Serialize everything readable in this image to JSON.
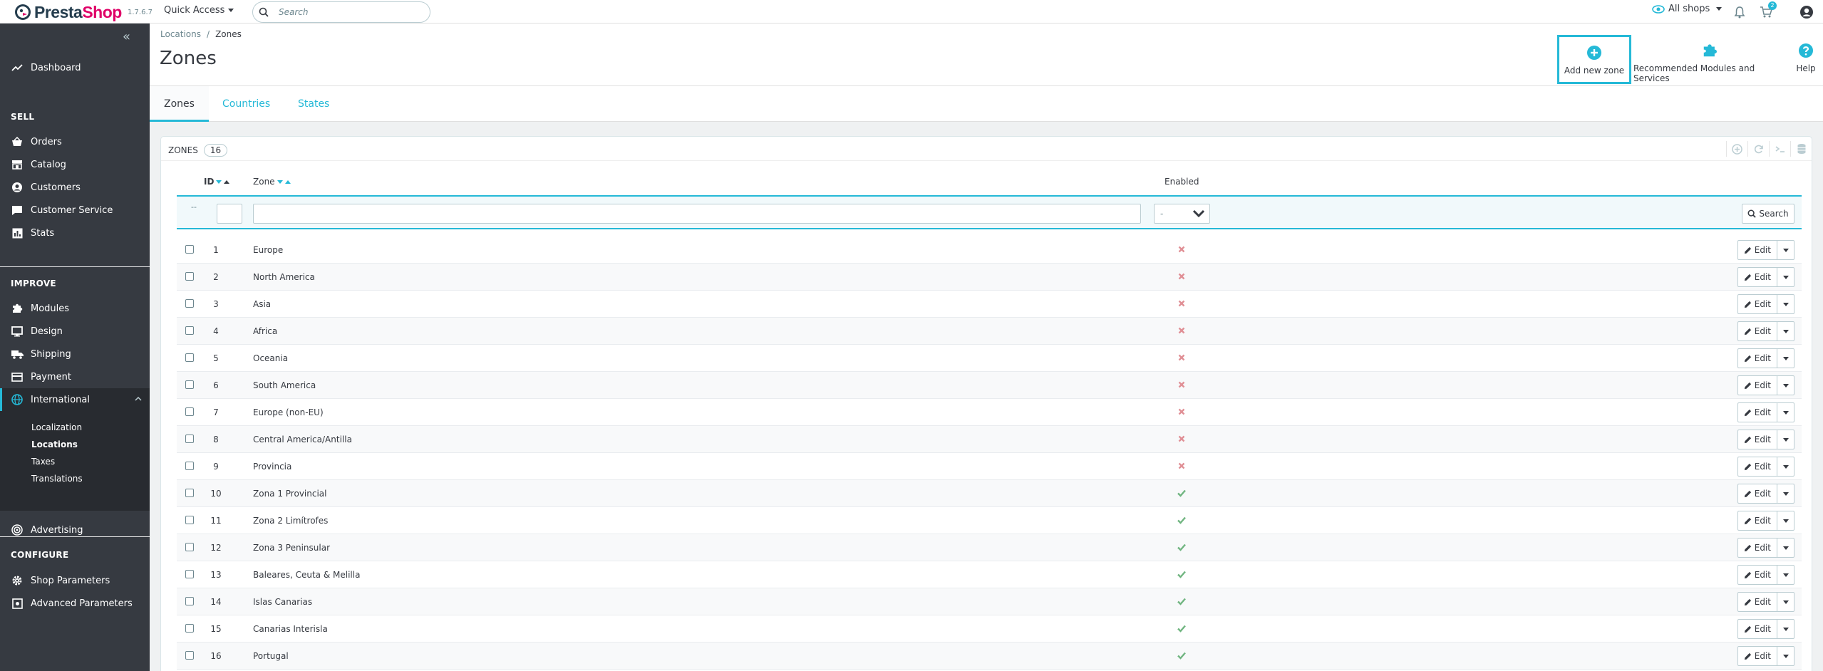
{
  "header": {
    "logo_prefix": "Presta",
    "logo_suffix": "Shop",
    "version": "1.7.6.7",
    "quick_access": "Quick Access",
    "search_placeholder": "Search",
    "shop_selector": "All shops",
    "orders_badge": "2"
  },
  "sidebar": {
    "dashboard": "Dashboard",
    "sections": {
      "sell": "SELL",
      "improve": "IMPROVE",
      "configure": "CONFIGURE"
    },
    "sell_items": [
      "Orders",
      "Catalog",
      "Customers",
      "Customer Service",
      "Stats"
    ],
    "improve_items": [
      "Modules",
      "Design",
      "Shipping",
      "Payment",
      "International"
    ],
    "international_sub": [
      "Localization",
      "Locations",
      "Taxes",
      "Translations"
    ],
    "advertising": "Advertising",
    "configure_items": [
      "Shop Parameters",
      "Advanced Parameters"
    ]
  },
  "page": {
    "breadcrumb": [
      "Locations",
      "Zones"
    ],
    "title": "Zones",
    "toolbar": {
      "add": "Add new zone",
      "recommended": "Recommended Modules and Services",
      "help": "Help"
    },
    "tabs": [
      "Zones",
      "Countries",
      "States"
    ]
  },
  "panel": {
    "title": "Zones",
    "count": "16",
    "columns": {
      "id": "ID",
      "zone": "Zone",
      "enabled": "Enabled"
    },
    "filter_dash": "--",
    "enabled_filter_value": "-",
    "search_button": "Search",
    "edit_label": "Edit",
    "rows": [
      {
        "id": "1",
        "zone": "Europe",
        "enabled": false
      },
      {
        "id": "2",
        "zone": "North America",
        "enabled": false
      },
      {
        "id": "3",
        "zone": "Asia",
        "enabled": false
      },
      {
        "id": "4",
        "zone": "Africa",
        "enabled": false
      },
      {
        "id": "5",
        "zone": "Oceania",
        "enabled": false
      },
      {
        "id": "6",
        "zone": "South America",
        "enabled": false
      },
      {
        "id": "7",
        "zone": "Europe (non-EU)",
        "enabled": false
      },
      {
        "id": "8",
        "zone": "Central America/Antilla",
        "enabled": false
      },
      {
        "id": "9",
        "zone": "Provincia",
        "enabled": false
      },
      {
        "id": "10",
        "zone": "Zona 1 Provincial",
        "enabled": true
      },
      {
        "id": "11",
        "zone": "Zona 2 Limítrofes",
        "enabled": true
      },
      {
        "id": "12",
        "zone": "Zona 3 Peninsular",
        "enabled": true
      },
      {
        "id": "13",
        "zone": "Baleares, Ceuta & Melilla",
        "enabled": true
      },
      {
        "id": "14",
        "zone": "Islas Canarias",
        "enabled": true
      },
      {
        "id": "15",
        "zone": "Canarias Interisla",
        "enabled": true
      },
      {
        "id": "16",
        "zone": "Portugal",
        "enabled": true
      }
    ]
  },
  "colors": {
    "accent": "#25b9d7",
    "sidebar_bg": "#363a41",
    "enabled_yes": "#70b580",
    "enabled_no": "#e08f95"
  }
}
